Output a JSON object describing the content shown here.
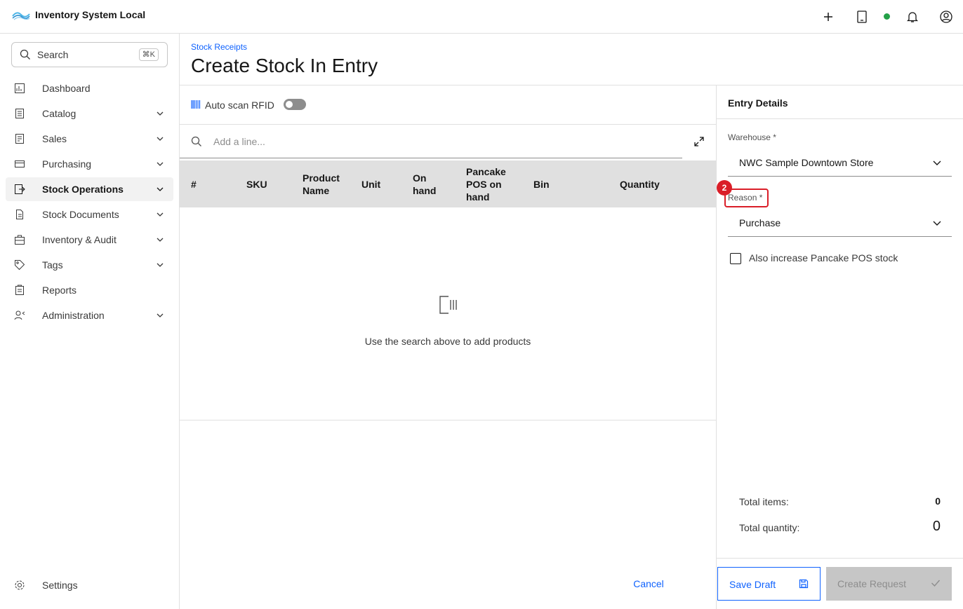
{
  "app": {
    "title": "Inventory System Local"
  },
  "header": {
    "icons": [
      "plus-icon",
      "tablet-icon",
      "status-online-dot",
      "notification-icon",
      "user-icon"
    ],
    "status_color": "#24a148"
  },
  "sidebar": {
    "search": {
      "label": "Search",
      "shortcut": "⌘K"
    },
    "items": [
      {
        "label": "Dashboard",
        "icon": "dashboard-icon",
        "expandable": false,
        "active": false
      },
      {
        "label": "Catalog",
        "icon": "catalog-icon",
        "expandable": true,
        "active": false
      },
      {
        "label": "Sales",
        "icon": "sales-icon",
        "expandable": true,
        "active": false
      },
      {
        "label": "Purchasing",
        "icon": "purchasing-icon",
        "expandable": true,
        "active": false
      },
      {
        "label": "Stock Operations",
        "icon": "stock-operations-icon",
        "expandable": true,
        "active": true
      },
      {
        "label": "Stock Documents",
        "icon": "document-icon",
        "expandable": true,
        "active": false
      },
      {
        "label": "Inventory & Audit",
        "icon": "inventory-icon",
        "expandable": true,
        "active": false
      },
      {
        "label": "Tags",
        "icon": "tag-icon",
        "expandable": true,
        "active": false
      },
      {
        "label": "Reports",
        "icon": "report-icon",
        "expandable": false,
        "active": false
      },
      {
        "label": "Administration",
        "icon": "admin-icon",
        "expandable": true,
        "active": false
      }
    ],
    "settings_label": "Settings"
  },
  "page": {
    "breadcrumb": "Stock Receipts",
    "title": "Create Stock In Entry"
  },
  "main": {
    "rfid_label": "Auto scan RFID",
    "rfid_enabled": false,
    "line_search_placeholder": "Add a line...",
    "columns": [
      "#",
      "SKU",
      "Product Name",
      "Unit",
      "On hand",
      "Pancake POS on hand",
      "Bin",
      "Quantity"
    ],
    "empty_text": "Use the search above to add products",
    "cancel_label": "Cancel"
  },
  "entry_details": {
    "title": "Entry Details",
    "warehouse_label": "Warehouse *",
    "warehouse_value": "NWC Sample Downtown Store",
    "reason_label": "Reason *",
    "reason_value": "Purchase",
    "step_badge": "2",
    "checkbox_label": "Also increase Pancake POS stock",
    "checkbox_checked": false,
    "total_items_label": "Total items:",
    "total_items_value": "0",
    "total_quantity_label": "Total quantity:",
    "total_quantity_value": "0",
    "save_draft_label": "Save Draft",
    "create_request_label": "Create Request"
  },
  "colors": {
    "accent": "#0f62fe",
    "highlight": "#da1e28",
    "disabled": "#c6c6c6"
  }
}
